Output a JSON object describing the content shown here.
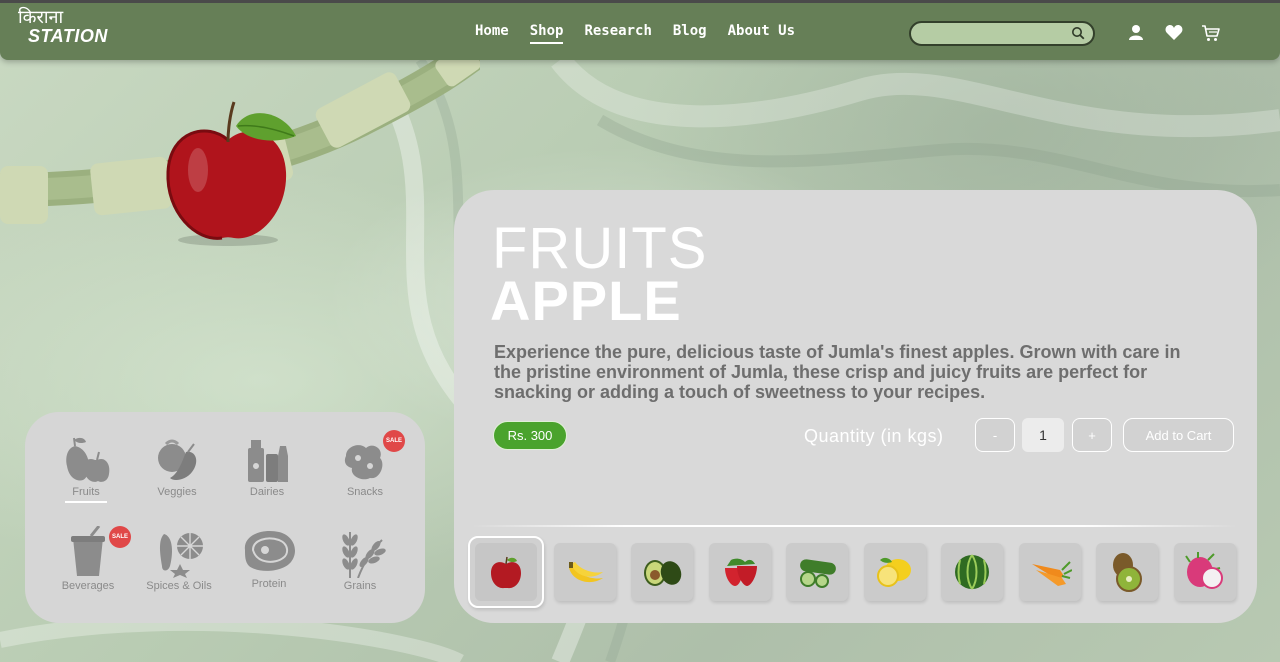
{
  "header": {
    "logo_hindi": "किराना",
    "logo_station": "STATION",
    "nav": [
      {
        "label": "Home",
        "active": false
      },
      {
        "label": "Shop",
        "active": true
      },
      {
        "label": "Research",
        "active": false
      },
      {
        "label": "Blog",
        "active": false
      },
      {
        "label": "About Us",
        "active": false
      }
    ],
    "search_value": "",
    "icons": [
      "search-icon",
      "user-icon",
      "heart-icon",
      "cart-icon"
    ]
  },
  "categories": [
    {
      "label": "Fruits",
      "icon": "fruits-icon",
      "active": true,
      "sale": false
    },
    {
      "label": "Veggies",
      "icon": "veggies-icon",
      "active": false,
      "sale": false
    },
    {
      "label": "Dairies",
      "icon": "dairies-icon",
      "active": false,
      "sale": false
    },
    {
      "label": "Snacks",
      "icon": "snacks-icon",
      "active": false,
      "sale": true
    },
    {
      "label": "Beverages",
      "icon": "beverages-icon",
      "active": false,
      "sale": true
    },
    {
      "label": "Spices & Oils",
      "icon": "spices-icon",
      "active": false,
      "sale": false
    },
    {
      "label": "Protein",
      "icon": "protein-icon",
      "active": false,
      "sale": false
    },
    {
      "label": "Grains",
      "icon": "grains-icon",
      "active": false,
      "sale": false
    }
  ],
  "sale_text": "SALE",
  "product": {
    "category": "FRUITS",
    "name": "APPLE",
    "description": "Experience the pure, delicious taste of Jumla's finest apples. Grown with care in the pristine environment of Jumla, these crisp and juicy fruits are perfect for snacking or adding a touch of sweetness to your recipes.",
    "price": "Rs. 300",
    "quantity_label": "Quantity (in kgs)",
    "decrement": "-",
    "quantity": "1",
    "increment": "+",
    "add_to_cart": "Add to Cart"
  },
  "thumbnails": [
    {
      "item": "apple-icon",
      "selected": true
    },
    {
      "item": "banana-icon",
      "selected": false
    },
    {
      "item": "avocado-icon",
      "selected": false
    },
    {
      "item": "strawberry-icon",
      "selected": false
    },
    {
      "item": "cucumber-icon",
      "selected": false
    },
    {
      "item": "lemon-icon",
      "selected": false
    },
    {
      "item": "watermelon-icon",
      "selected": false
    },
    {
      "item": "carrot-icon",
      "selected": false
    },
    {
      "item": "kiwi-icon",
      "selected": false
    },
    {
      "item": "dragonfruit-icon",
      "selected": false
    }
  ],
  "colors": {
    "nav_bg": "#667f57",
    "price_green": "#4aa32d",
    "sale_red": "#e04848",
    "card_bg": "#d9d9d9"
  }
}
